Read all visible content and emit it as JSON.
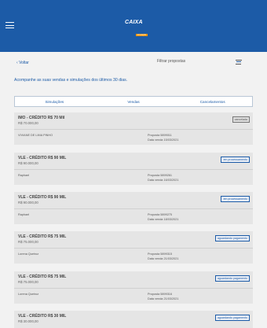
{
  "header": {
    "logo_text": "CAIXA",
    "logo_tag": "simulação",
    "menu_icon": "hamburger-menu-icon"
  },
  "nav": {
    "back_label": "Voltar",
    "filter_label": "Filtrar propostas",
    "filter_icon": "filter-sliders-icon"
  },
  "intro_text": "Acompanhe as suas vendas e simulações dos últimos 30 dias.",
  "tabs": [
    {
      "label": "Simulações"
    },
    {
      "label": "Vendas"
    },
    {
      "label": "Cancelamentos"
    }
  ],
  "cards": [
    {
      "title": "IMO - CRÉDITO  R$  70 Mil",
      "value": "R$ 70.000,00",
      "status": "cancelada",
      "client": "VIVIANE DE LIMA PINHO",
      "proposal": "Proposta 5899011",
      "date": "Data venda 15/03/2021"
    },
    {
      "title": "VLE - CRÉDITO R$  90 MIL",
      "value": "R$ 90.000,00",
      "status": "em processamento",
      "client": "Raphael",
      "proposal": "Proposta 5899261",
      "date": "Data venda 16/03/2021"
    },
    {
      "title": "VLE - CRÉDITO R$  90 MIL",
      "value": "R$ 90.000,00",
      "status": "em processamento",
      "client": "Raphael",
      "proposal": "Proposta 5899275",
      "date": "Data venda 18/03/2021"
    },
    {
      "title": "VLE - CRÉDITO R$  75 MIL",
      "value": "R$ 75.000,00",
      "status": "aguardando pagamento",
      "client": "Lorena Queiroz",
      "proposal": "Proposta 5899315",
      "date": "Data venda 21/03/2021"
    },
    {
      "title": "VLE - CRÉDITO R$  75 MIL",
      "value": "R$ 75.000,00",
      "status": "aguardando pagamento",
      "client": "Lorena Queiroz",
      "proposal": "Proposta 5899316",
      "date": "Data venda 21/03/2021"
    },
    {
      "title": "VLE - CRÉDITO R$  30 MIL",
      "value": "R$ 30.000,00",
      "status": "aguardando pagamento"
    }
  ]
}
